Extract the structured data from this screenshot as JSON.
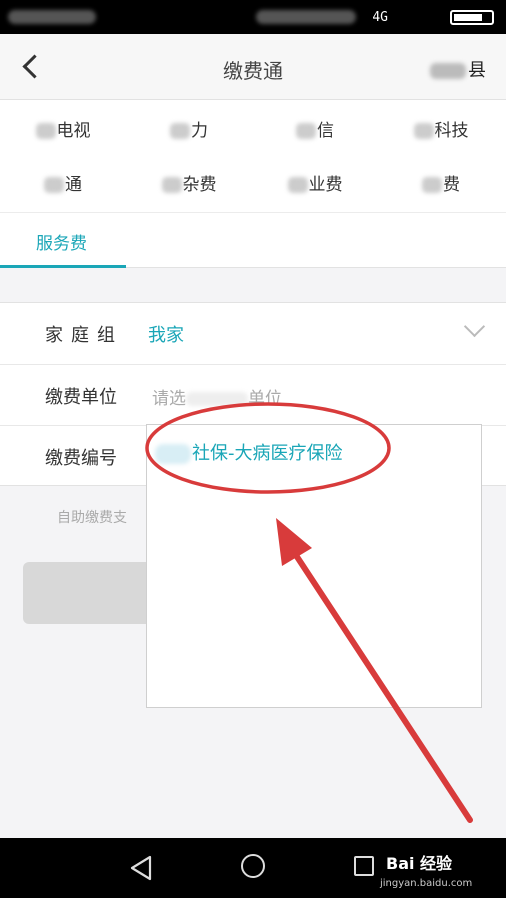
{
  "status_bar": {
    "signal_text": "4G"
  },
  "header": {
    "title": "缴费通",
    "region": "县"
  },
  "categories": [
    "电视",
    "力",
    "信",
    "科技",
    "通",
    "杂费",
    "业费",
    "费"
  ],
  "tab": {
    "label": "服务费"
  },
  "form": {
    "family_label": "家庭组",
    "family_value": "我家",
    "unit_label": "缴费单位",
    "unit_placeholder_prefix": "请选",
    "unit_placeholder_suffix": "单位",
    "number_label": "缴费编号"
  },
  "tip": "自助缴费支",
  "dropdown": {
    "option_label": "社保-大病医疗保险"
  },
  "watermark": {
    "brand": "Bai 经验",
    "url": "jingyan.baidu.com"
  },
  "colors": {
    "accent": "#1aa6b7",
    "annotation_red": "#d83b3b"
  }
}
